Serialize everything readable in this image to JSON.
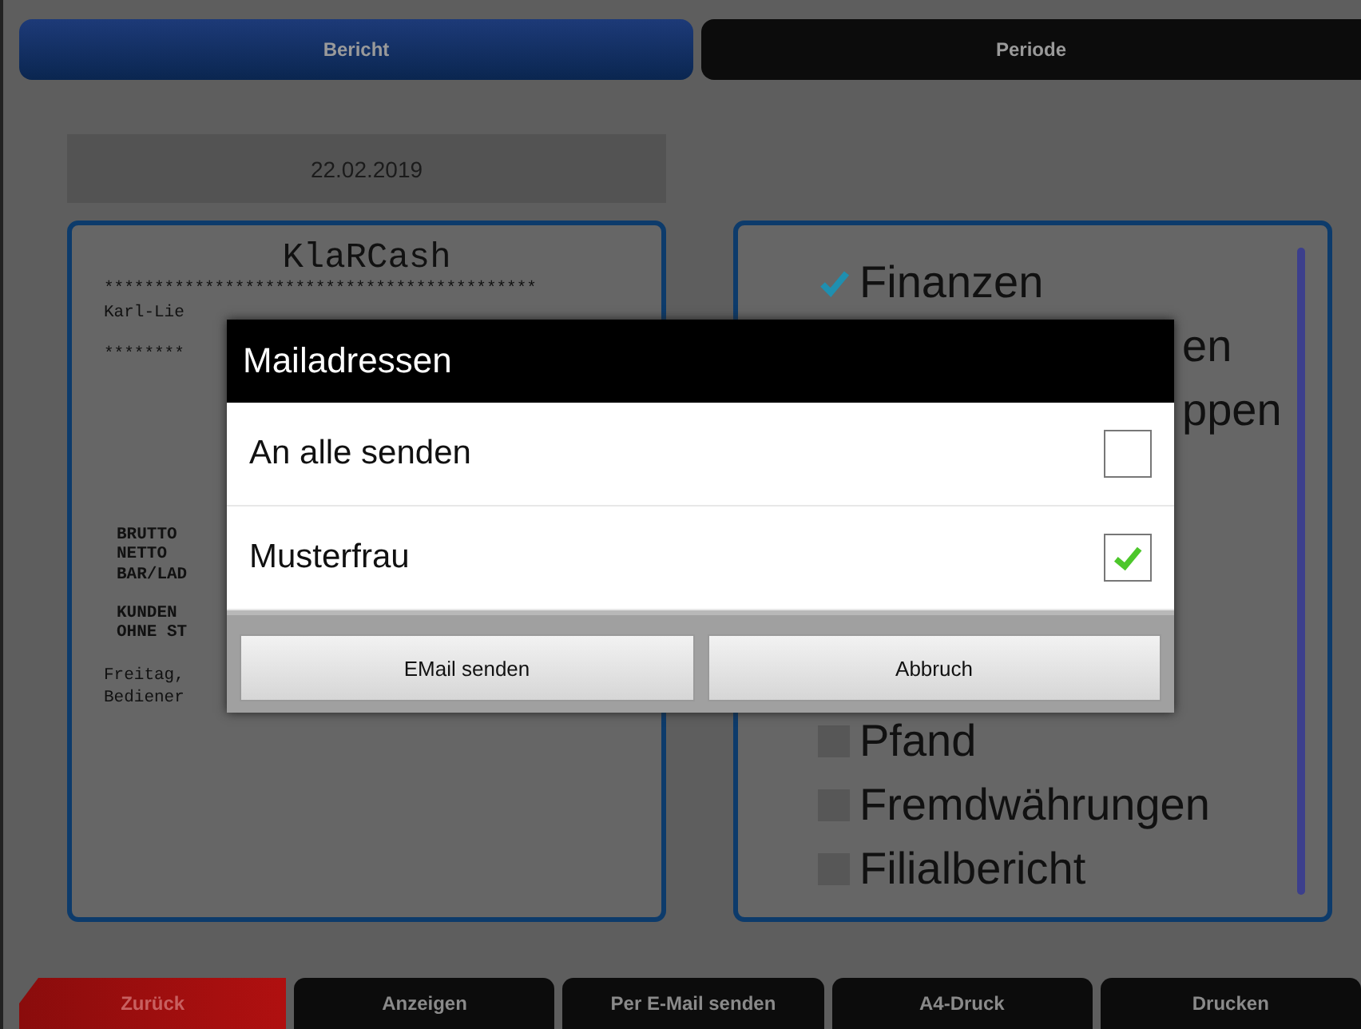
{
  "tabs": [
    {
      "label": "Bericht",
      "selected": true
    },
    {
      "label": "Periode",
      "selected": false
    }
  ],
  "date_field": {
    "value": "22.02.2019"
  },
  "receipt": {
    "title": "KlaRCash",
    "lines_top": [
      "*******************************************",
      "Karl-Lie",
      "********"
    ],
    "lines_middle": [
      "BRUTTO",
      "NETTO",
      "BAR/LAD",
      "KUNDEN",
      "OHNE ST"
    ],
    "lines_bottom": [
      "Freitag,",
      "Bediener"
    ]
  },
  "report_options": {
    "above": [
      {
        "label": "Finanzen",
        "checked": true,
        "kind": "full"
      },
      {
        "label": "en",
        "kind": "covered"
      },
      {
        "label": "ppen",
        "kind": "covered"
      }
    ],
    "below": [
      {
        "label": "Pfand",
        "checked": false,
        "kind": "full"
      },
      {
        "label": "Fremdwährungen",
        "checked": false,
        "kind": "full"
      },
      {
        "label": "Filialbericht",
        "checked": false,
        "kind": "full"
      }
    ]
  },
  "dialog": {
    "title": "Mailadressen",
    "items": [
      {
        "label": "An alle senden",
        "checked": false
      },
      {
        "label": "Musterfrau",
        "checked": true
      }
    ],
    "buttons": [
      "EMail senden",
      "Abbruch"
    ]
  },
  "bottom_bar": [
    {
      "label": "Zurück",
      "kind": "back"
    },
    {
      "label": "Anzeigen",
      "kind": "normal"
    },
    {
      "label": "Per E-Mail senden",
      "kind": "normal"
    },
    {
      "label": "A4-Druck",
      "kind": "normal"
    },
    {
      "label": "Drucken",
      "kind": "normal"
    }
  ]
}
